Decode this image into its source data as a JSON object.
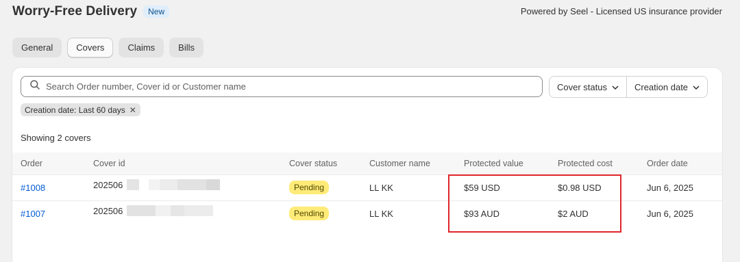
{
  "header": {
    "title": "Worry-Free Delivery",
    "badge": "New",
    "powered_by": "Powered by Seel - Licensed US insurance provider"
  },
  "tabs": [
    {
      "label": "General"
    },
    {
      "label": "Covers"
    },
    {
      "label": "Claims"
    },
    {
      "label": "Bills"
    }
  ],
  "active_tab": "Covers",
  "search": {
    "placeholder": "Search Order number, Cover id or Customer name",
    "value": ""
  },
  "filters": {
    "cover_status": "Cover status",
    "creation_date": "Creation date"
  },
  "applied_filter": {
    "label": "Creation date: Last 60 days"
  },
  "showing_text": "Showing 2 covers",
  "table": {
    "columns": [
      "Order",
      "Cover id",
      "Cover status",
      "Customer name",
      "Protected value",
      "Protected cost",
      "Order date"
    ],
    "rows": [
      {
        "order": "#1008",
        "cover_id": "202506",
        "status": "Pending",
        "customer": "LL KK",
        "protected_value": "$59 USD",
        "protected_cost": "$0.98 USD",
        "order_date": "Jun 6, 2025"
      },
      {
        "order": "#1007",
        "cover_id": "202506",
        "status": "Pending",
        "customer": "LL KK",
        "protected_value": "$93 AUD",
        "protected_cost": "$2 AUD",
        "order_date": "Jun 6, 2025"
      }
    ]
  },
  "colors": {
    "highlight_border": "#e0242b",
    "link": "#005bd3",
    "pending_badge": "#ffeb78"
  }
}
